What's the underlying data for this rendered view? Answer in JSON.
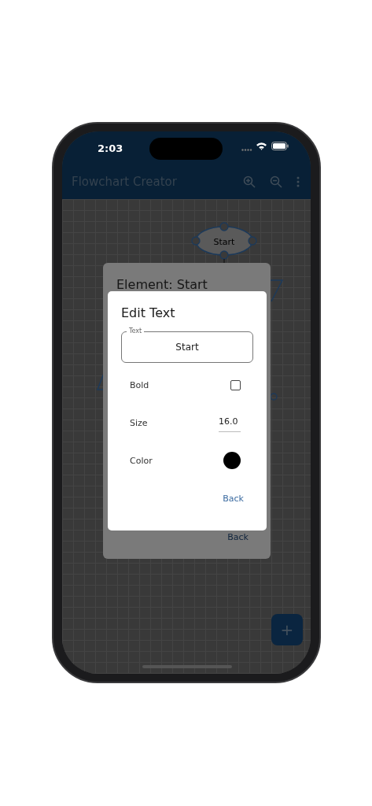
{
  "status_bar": {
    "time": "2:03"
  },
  "app_bar": {
    "title": "Flowchart Creator"
  },
  "canvas": {
    "nodes": [
      {
        "label": "Start"
      }
    ]
  },
  "element_dialog": {
    "title": "Element: Start",
    "button": "Back"
  },
  "edit_dialog": {
    "title": "Edit Text",
    "text_field": {
      "label": "Text",
      "value": "Start"
    },
    "rows": [
      {
        "kind": "checkbox",
        "label": "Bold",
        "checked": false
      },
      {
        "kind": "number",
        "label": "Size",
        "value": "16.0"
      },
      {
        "kind": "color",
        "label": "Color",
        "color": "#000000"
      }
    ],
    "button": "Back"
  },
  "fab": {
    "label": "+"
  }
}
